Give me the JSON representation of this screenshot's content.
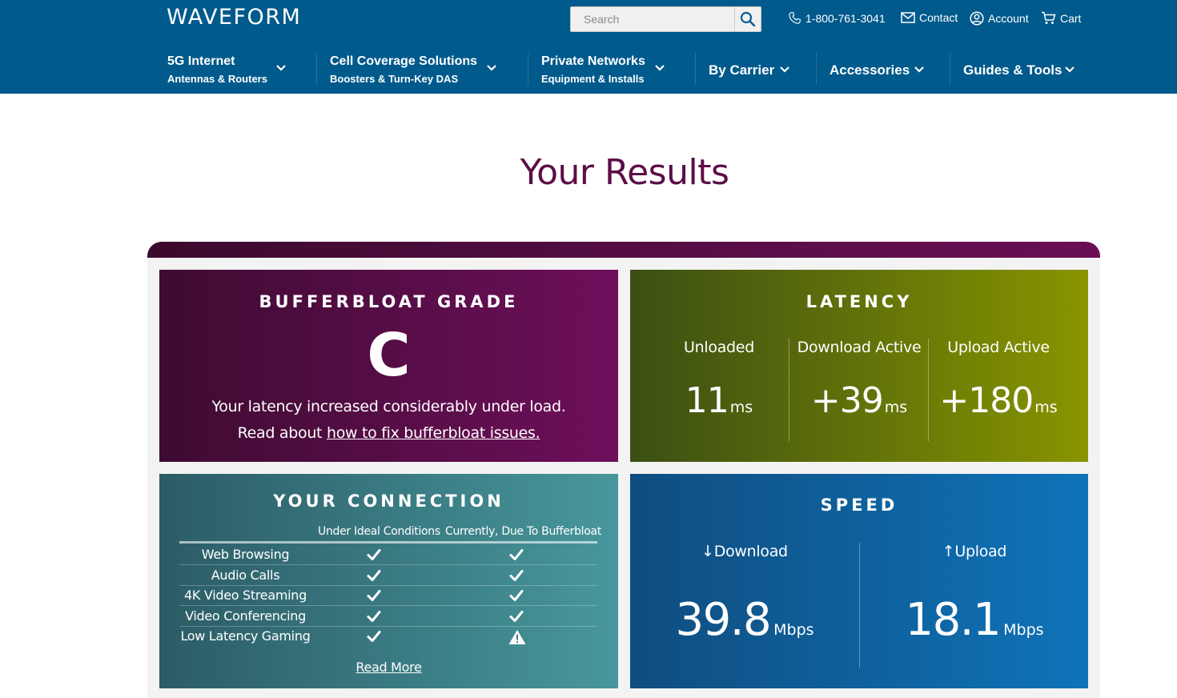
{
  "header": {
    "logo": "WAVEFORM",
    "search_placeholder": "Search",
    "phone": "1-800-761-3041",
    "contact": "Contact",
    "account": "Account",
    "cart": "Cart",
    "icons": [
      "search-icon",
      "phone-icon",
      "mail-icon",
      "user-circle-icon",
      "cart-icon"
    ]
  },
  "nav": [
    {
      "title": "5G Internet",
      "subtitle": "Antennas & Routers"
    },
    {
      "title": "Cell Coverage Solutions",
      "subtitle": "Boosters & Turn-Key DAS"
    },
    {
      "title": "Private Networks",
      "subtitle": "Equipment & Installs"
    },
    {
      "title": "By Carrier",
      "subtitle": ""
    },
    {
      "title": "Accessories",
      "subtitle": ""
    },
    {
      "title": "Guides & Tools",
      "subtitle": ""
    }
  ],
  "page_title": "Your Results",
  "grade": {
    "title": "BUFFERBLOAT GRADE",
    "letter": "C",
    "line1": "Your latency increased considerably under load.",
    "line2_prefix": "Read about ",
    "line2_link": "how to fix bufferbloat issues."
  },
  "latency": {
    "title": "LATENCY",
    "columns": [
      {
        "label": "Unloaded",
        "value": "11",
        "unit": "ms"
      },
      {
        "label": "Download Active",
        "value": "+39",
        "unit": "ms"
      },
      {
        "label": "Upload Active",
        "value": "+180",
        "unit": "ms"
      }
    ]
  },
  "connection": {
    "title": "YOUR CONNECTION",
    "col_ideal": "Under Ideal Conditions",
    "col_current": "Currently, Due To Bufferbloat",
    "rows": [
      {
        "label": "Web Browsing",
        "ideal": "check-icon",
        "current": "check-icon"
      },
      {
        "label": "Audio Calls",
        "ideal": "check-icon",
        "current": "check-icon"
      },
      {
        "label": "4K Video Streaming",
        "ideal": "check-icon",
        "current": "check-icon"
      },
      {
        "label": "Video Conferencing",
        "ideal": "check-icon",
        "current": "check-icon"
      },
      {
        "label": "Low Latency Gaming",
        "ideal": "check-icon",
        "current": "warning-icon"
      }
    ],
    "read_more": "Read More"
  },
  "speed": {
    "title": "SPEED",
    "download_label": "↓Download",
    "download_value": "39.8",
    "download_unit": "Mbps",
    "upload_label": "↑Upload",
    "upload_value": "18.1",
    "upload_unit": "Mbps"
  },
  "colors": {
    "header_bg": "#005a8c",
    "title": "#5b0e47",
    "grade_card": "#6e0f5b",
    "latency_card": "#889400",
    "connection_card": "#47979c",
    "speed_card": "#0f73b8"
  }
}
